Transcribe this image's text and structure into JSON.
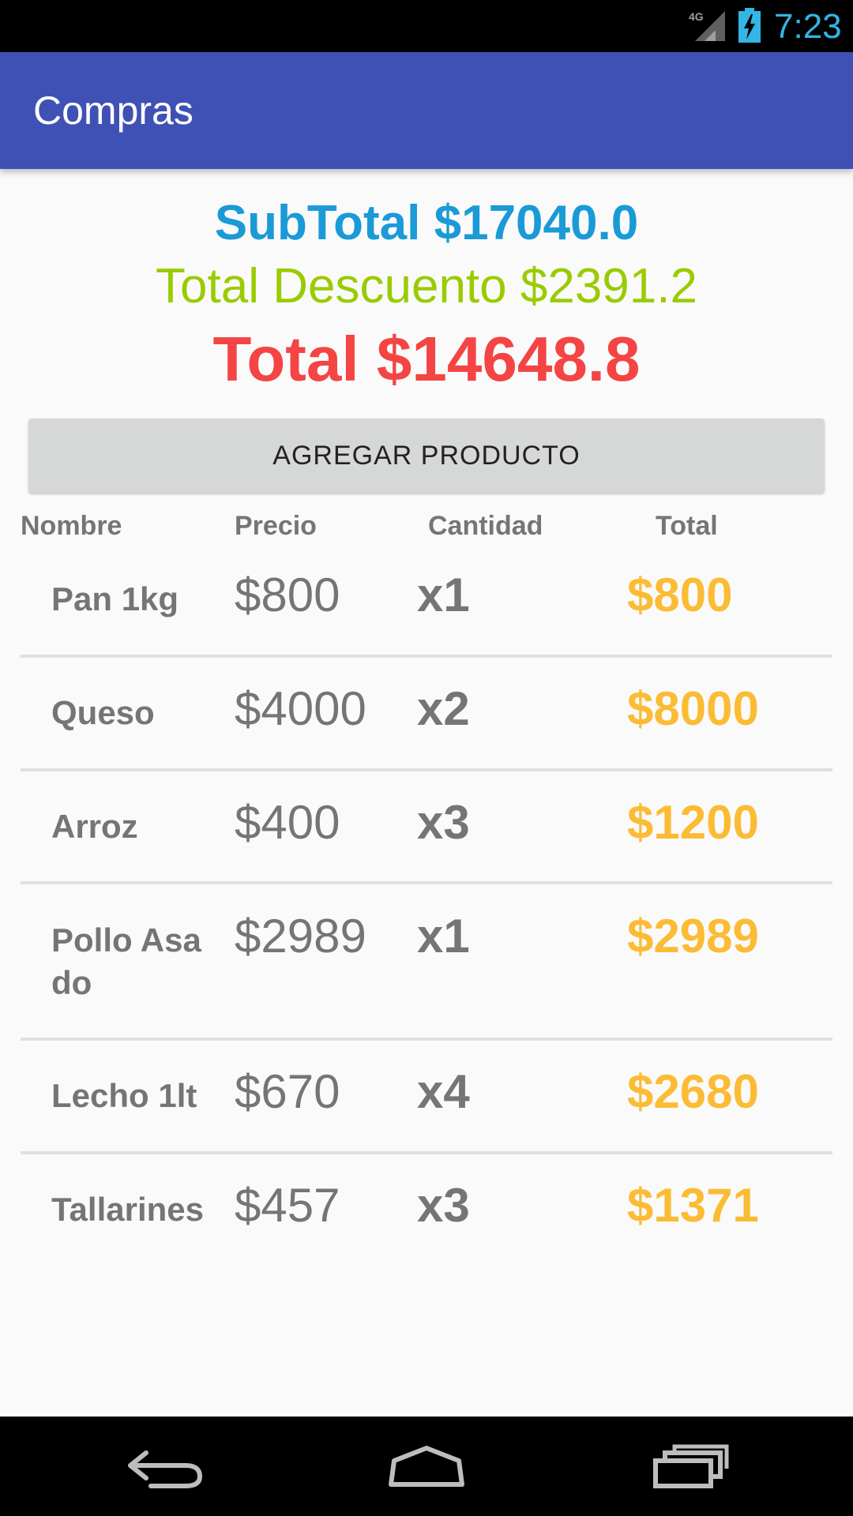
{
  "status_bar": {
    "network": "4G",
    "time": "7:23"
  },
  "app_bar": {
    "title": "Compras"
  },
  "summary": {
    "subtotal": "SubTotal $17040.0",
    "discount": "Total Descuento $2391.2",
    "total": "Total $14648.8"
  },
  "add_button_label": "AGREGAR PRODUCTO",
  "table": {
    "headers": [
      "Nombre",
      "Precio",
      "Cantidad",
      "Total"
    ],
    "rows": [
      {
        "name": "Pan 1kg",
        "price": "$800",
        "qty": "x1",
        "total": "$800"
      },
      {
        "name": "Queso",
        "price": "$4000",
        "qty": "x2",
        "total": "$8000"
      },
      {
        "name": "Arroz",
        "price": "$400",
        "qty": "x3",
        "total": "$1200"
      },
      {
        "name": "Pollo Asado",
        "price": "$2989",
        "qty": "x1",
        "total": "$2989"
      },
      {
        "name": "Lecho 1lt",
        "price": "$670",
        "qty": "x4",
        "total": "$2680"
      },
      {
        "name": "Tallarines",
        "price": "$457",
        "qty": "x3",
        "total": "$1371"
      }
    ]
  },
  "colors": {
    "app_bar": "#3f51b5",
    "subtotal": "#1a9ad6",
    "discount": "#99cc00",
    "total": "#f44444",
    "row_total": "#fbbc34",
    "clock": "#33b5e5"
  },
  "icons": {
    "signal": "signal-4g-icon",
    "battery": "battery-charging-icon",
    "back": "back-icon",
    "home": "home-icon",
    "recents": "recents-icon"
  }
}
